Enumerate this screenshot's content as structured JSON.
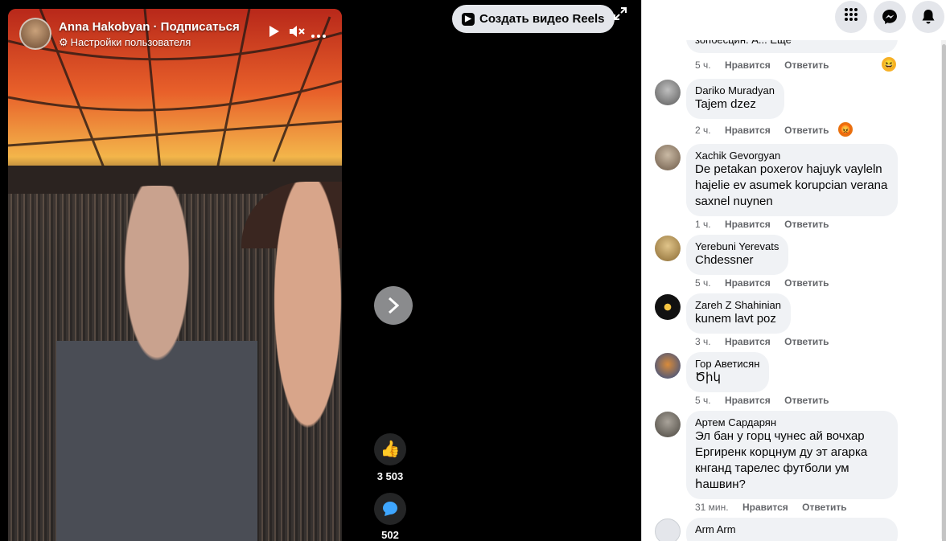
{
  "video": {
    "owner_name": "Anna Hakobyan · Подписаться",
    "owner_subtitle": "Настройки пользователя",
    "play_icon": "play-icon",
    "mute_icon": "speaker-muted-icon",
    "more_icon": "more-icon"
  },
  "top": {
    "create_reels_label": "Создать видео Reels"
  },
  "actions": {
    "likes": "3 503",
    "comments": "502"
  },
  "comments": [
    {
      "name": "",
      "text": "зопбесцин. А... Еще",
      "time": "5 ч.",
      "like": "Нравится",
      "reply": "Ответить",
      "reaction": "laugh"
    },
    {
      "name": "Dariko Muradyan",
      "text": "Tajem dzez",
      "time": "2 ч.",
      "like": "Нравится",
      "reply": "Ответить",
      "reaction": "angry"
    },
    {
      "name": "Xachik Gevorgyan",
      "text": "De petakan poxerov hajuyk vayleln\nhajelie ev asumek korupcian verana\nsaxnel nuynen",
      "time": "1 ч.",
      "like": "Нравится",
      "reply": "Ответить"
    },
    {
      "name": "Yerebuni Yerevats",
      "text": "Chdessner",
      "time": "5 ч.",
      "like": "Нравится",
      "reply": "Ответить"
    },
    {
      "name": "Zareh Z Shahinian",
      "text": "kunem lavt poz",
      "time": "3 ч.",
      "like": "Нравится",
      "reply": "Ответить"
    },
    {
      "name": "Гор Аветисян",
      "text": "Ծիկ",
      "time": "5 ч.",
      "like": "Нравится",
      "reply": "Ответить"
    },
    {
      "name": "Артем Сардарян",
      "text": "Эл бан у горц чунес ай вочхар\nЕргиренк корцнум ду эт агарка\nкнганд тарелес футболи ум\nհашвин?",
      "time": "31 мин.",
      "like": "Нравится",
      "reply": "Ответить"
    },
    {
      "name": "Arm Arm",
      "text": "",
      "time": "",
      "like": "",
      "reply": ""
    }
  ]
}
